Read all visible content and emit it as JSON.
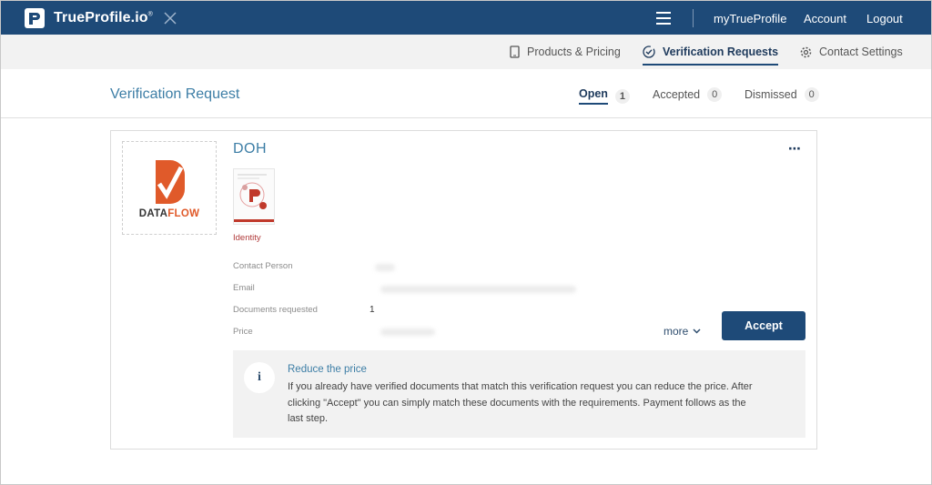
{
  "topbar": {
    "brand": "TrueProfile.io",
    "brand_mark": "®",
    "nav": [
      "myTrueProfile",
      "Account",
      "Logout"
    ]
  },
  "subnav": {
    "items": [
      {
        "label": "Products & Pricing",
        "icon": "tablet-icon"
      },
      {
        "label": "Verification Requests",
        "icon": "check-circle-icon",
        "active": true
      },
      {
        "label": "Contact Settings",
        "icon": "gear-icon"
      }
    ]
  },
  "page": {
    "title": "Verification Request",
    "tabs": [
      {
        "label": "Open",
        "count": "1",
        "active": true
      },
      {
        "label": "Accepted",
        "count": "0"
      },
      {
        "label": "Dismissed",
        "count": "0"
      }
    ]
  },
  "request": {
    "company_logo_text_a": "DATA",
    "company_logo_text_b": "FLOW",
    "company_name": "DOH",
    "more_menu": "⋯",
    "document_label": "Identity",
    "fields": {
      "contact_person": "Contact Person",
      "email": "Email",
      "documents_requested": "Documents requested",
      "documents_requested_value": "1",
      "price": "Price"
    },
    "more_link": "more",
    "accept_button": "Accept"
  },
  "info": {
    "icon_glyph": "i",
    "title": "Reduce the price",
    "text": "If you already have verified documents that match this verification request you can reduce the price. After clicking \"Accept\" you can simply match these documents with the requirements. Payment follows as the last step."
  },
  "colors": {
    "header": "#1e4a78",
    "accent": "#3d7ea6",
    "logo_orange": "#e05a2a"
  }
}
